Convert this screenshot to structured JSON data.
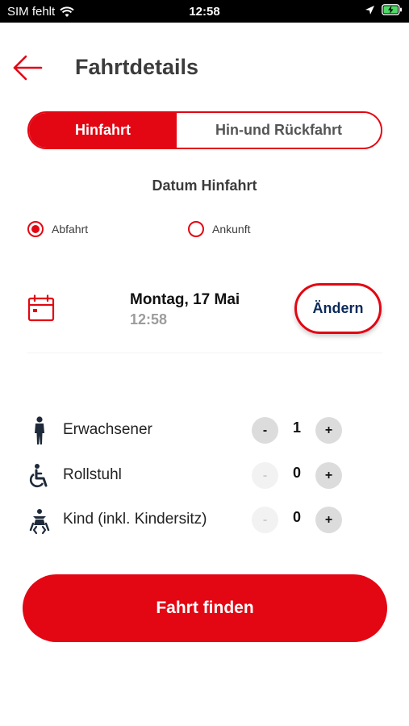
{
  "status_bar": {
    "carrier": "SIM fehlt",
    "time": "12:58",
    "wifi_icon": "wifi-icon",
    "location_icon": "location-arrow-icon",
    "battery_icon": "battery-charging-icon"
  },
  "header": {
    "back_icon": "arrow-left-icon",
    "title": "Fahrtdetails"
  },
  "trip_type": {
    "options": [
      "Hinfahrt",
      "Hin-und Rückfahrt"
    ],
    "selected": "Hinfahrt"
  },
  "date_section": {
    "title": "Datum Hinfahrt",
    "radio_departure": "Abfahrt",
    "radio_arrival": "Ankunft",
    "selected_radio": "Abfahrt",
    "calendar_icon": "calendar-icon",
    "date": "Montag, 17 Mai",
    "time": "12:58",
    "change_label": "Ändern"
  },
  "passengers": [
    {
      "label": "Erwachsener",
      "count": "1",
      "icon": "adult-person-icon",
      "minus": "-",
      "plus": "+",
      "minus_enabled": true
    },
    {
      "label": "Rollstuhl",
      "count": "0",
      "icon": "wheelchair-icon",
      "minus": "-",
      "plus": "+",
      "minus_enabled": false
    },
    {
      "label": "Kind (inkl. Kindersitz)",
      "count": "0",
      "icon": "child-seat-icon",
      "minus": "-",
      "plus": "+",
      "minus_enabled": false
    }
  ],
  "cta_label": "Fahrt finden",
  "colors": {
    "accent": "#e30613",
    "change_text": "#0b2a5a"
  }
}
